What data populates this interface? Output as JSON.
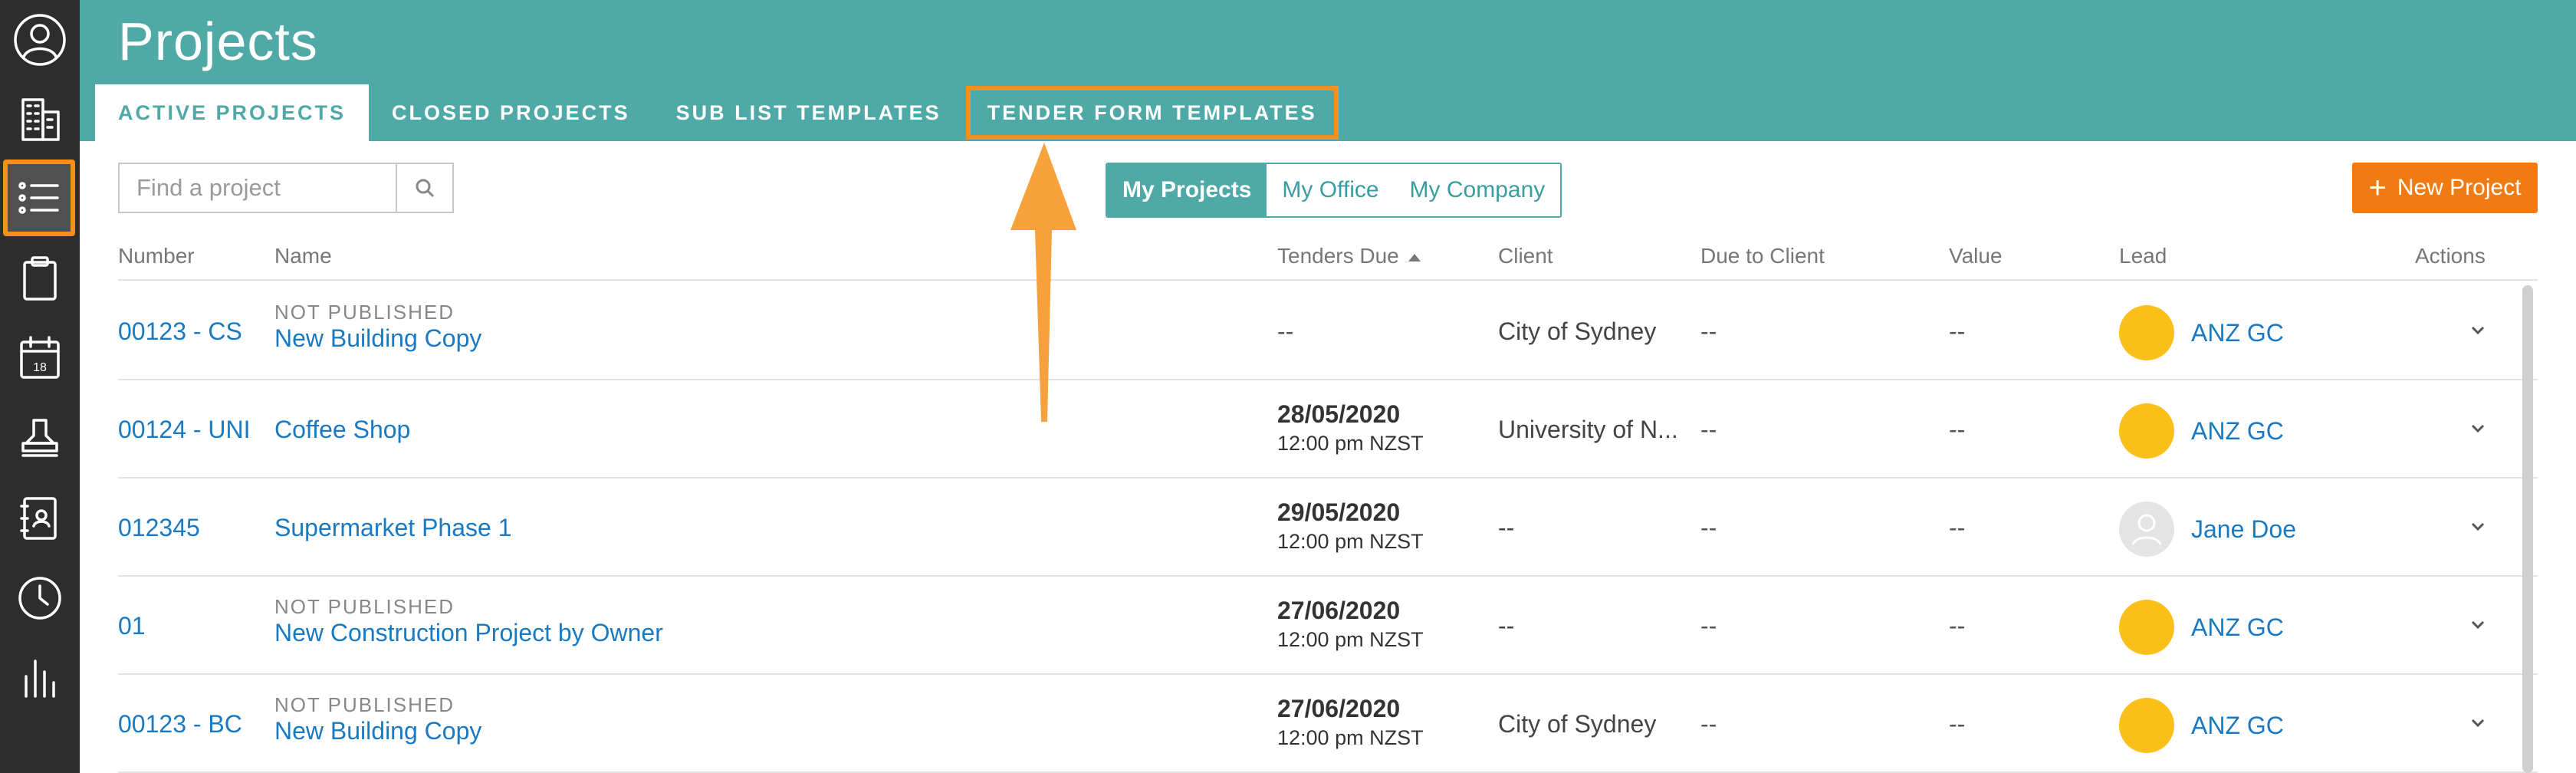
{
  "sidebar": {
    "items": [
      {
        "icon": "user-circle-icon"
      },
      {
        "icon": "building-icon"
      },
      {
        "icon": "list-icon",
        "active": true
      },
      {
        "icon": "clipboard-icon"
      },
      {
        "icon": "calendar-icon",
        "text": "18"
      },
      {
        "icon": "stamp-icon"
      },
      {
        "icon": "address-book-icon"
      },
      {
        "icon": "clock-icon"
      },
      {
        "icon": "bar-chart-icon"
      }
    ]
  },
  "header": {
    "title": "Projects",
    "tabs": [
      {
        "label": "ACTIVE PROJECTS",
        "active": true
      },
      {
        "label": "CLOSED PROJECTS"
      },
      {
        "label": "SUB LIST TEMPLATES"
      },
      {
        "label": "TENDER FORM TEMPLATES",
        "highlighted": true
      }
    ]
  },
  "toolbar": {
    "search_placeholder": "Find a project",
    "scope": [
      {
        "label": "My Projects",
        "active": true
      },
      {
        "label": "My Office"
      },
      {
        "label": "My Company"
      }
    ],
    "new_project_label": "New Project"
  },
  "table": {
    "columns": [
      "Number",
      "Name",
      "Tenders Due",
      "Client",
      "Due to Client",
      "Value",
      "Lead",
      "Actions"
    ],
    "rows": [
      {
        "number": "00123 - CS",
        "status": "NOT PUBLISHED",
        "name": "New Building Copy",
        "tender_date": "--",
        "tender_time": "",
        "client": "City of Sydney",
        "due_to_client": "--",
        "value": "--",
        "lead": "ANZ GC"
      },
      {
        "number": "00124 - UNI",
        "status": "",
        "name": "Coffee Shop",
        "tender_date": "28/05/2020",
        "tender_time": "12:00 pm NZST",
        "client": "University of N...",
        "due_to_client": "--",
        "value": "--",
        "lead": "ANZ GC"
      },
      {
        "number": "012345",
        "status": "",
        "name": "Supermarket Phase 1",
        "tender_date": "29/05/2020",
        "tender_time": "12:00 pm NZST",
        "client": "--",
        "due_to_client": "--",
        "value": "--",
        "lead": "Jane Doe"
      },
      {
        "number": "01",
        "status": "NOT PUBLISHED",
        "name": "New Construction Project by Owner",
        "tender_date": "27/06/2020",
        "tender_time": "12:00 pm NZST",
        "client": "--",
        "due_to_client": "--",
        "value": "--",
        "lead": "ANZ GC"
      },
      {
        "number": "00123 - BC",
        "status": "NOT PUBLISHED",
        "name": "New Building Copy",
        "tender_date": "27/06/2020",
        "tender_time": "12:00 pm NZST",
        "client": "City of Sydney",
        "due_to_client": "--",
        "value": "--",
        "lead": "ANZ GC"
      }
    ]
  },
  "colors": {
    "teal": "#4fa9a6",
    "orange": "#f5901e",
    "link_blue": "#1a7ac1",
    "sidebar": "#2d2d2d"
  }
}
